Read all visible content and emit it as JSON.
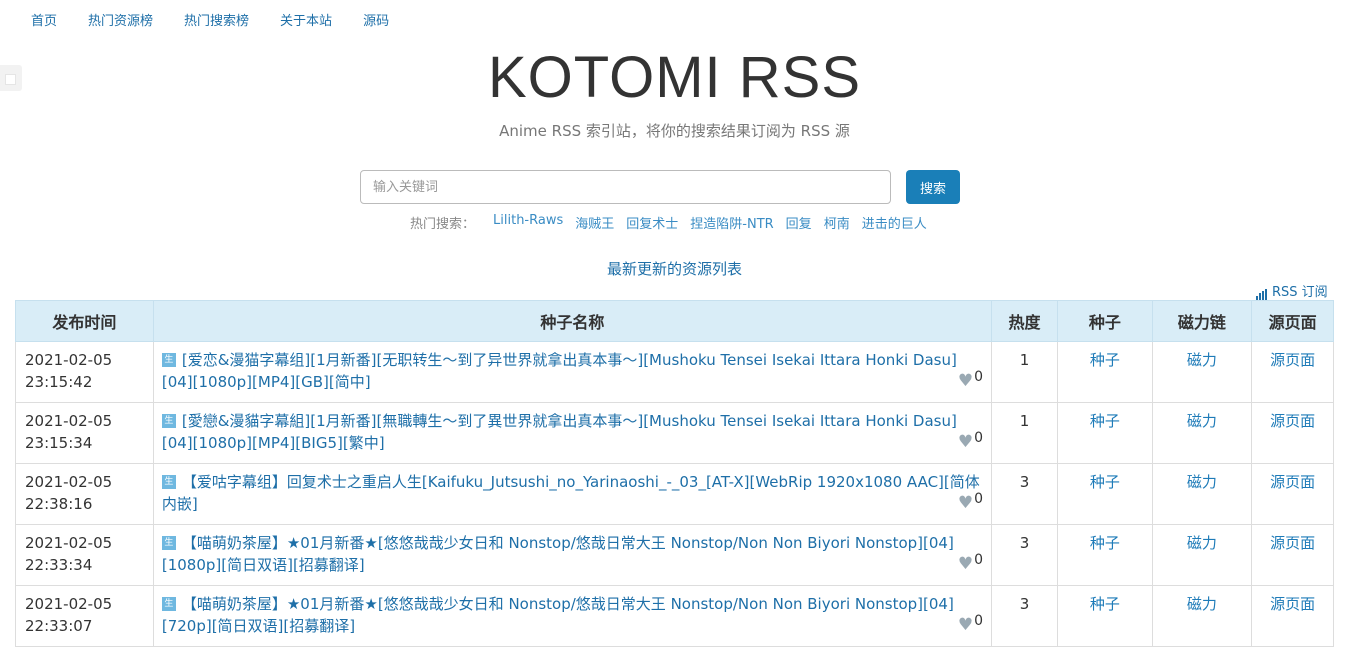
{
  "nav": [
    "首页",
    "热门资源榜",
    "热门搜索榜",
    "关于本站",
    "源码"
  ],
  "hero": {
    "title": "KOTOMI RSS",
    "subtitle": "Anime RSS 索引站，将你的搜索结果订阅为 RSS 源"
  },
  "search": {
    "placeholder": "输入关键词",
    "button": "搜索",
    "hot_label": "热门搜索：",
    "hot_terms": [
      "Lilith-Raws",
      "海贼王",
      "回复术士",
      "捏造陷阱-NTR",
      "回复",
      "柯南",
      "进击的巨人"
    ]
  },
  "section_title": "最新更新的资源列表",
  "rss_label": "RSS 订阅",
  "table": {
    "headers": [
      "发布时间",
      "种子名称",
      "热度",
      "种子",
      "磁力链",
      "源页面"
    ],
    "rows": [
      {
        "date": "2021-02-05",
        "time": "23:15:42",
        "tag": "生",
        "title": "[爱恋&漫猫字幕组][1月新番][无职转生～到了异世界就拿出真本事～][Mushoku Tensei Isekai Ittara Honki Dasu][04][1080p][MP4][GB][简中]",
        "fav": "0",
        "heat": "1",
        "seed": "种子",
        "magnet": "磁力",
        "source": "源页面"
      },
      {
        "date": "2021-02-05",
        "time": "23:15:34",
        "tag": "生",
        "title": "[愛戀&漫貓字幕組][1月新番][無職轉生～到了異世界就拿出真本事～][Mushoku Tensei Isekai Ittara Honki Dasu][04][1080p][MP4][BIG5][繁中]",
        "fav": "0",
        "heat": "1",
        "seed": "种子",
        "magnet": "磁力",
        "source": "源页面"
      },
      {
        "date": "2021-02-05",
        "time": "22:38:16",
        "tag": "生",
        "title": "【爱咕字幕组】回复术士之重启人生[Kaifuku_Jutsushi_no_Yarinaoshi_-_03_[AT-X][WebRip 1920x1080 AAC][简体内嵌]",
        "fav": "0",
        "heat": "3",
        "seed": "种子",
        "magnet": "磁力",
        "source": "源页面"
      },
      {
        "date": "2021-02-05",
        "time": "22:33:34",
        "tag": "生",
        "title": "【喵萌奶茶屋】★01月新番★[悠悠哉哉少女日和 Nonstop/悠哉日常大王 Nonstop/Non Non Biyori Nonstop][04][1080p][简日双语][招募翻译]",
        "fav": "0",
        "heat": "3",
        "seed": "种子",
        "magnet": "磁力",
        "source": "源页面"
      },
      {
        "date": "2021-02-05",
        "time": "22:33:07",
        "tag": "生",
        "title": "【喵萌奶茶屋】★01月新番★[悠悠哉哉少女日和 Nonstop/悠哉日常大王 Nonstop/Non Non Biyori Nonstop][04][720p][简日双语][招募翻译]",
        "fav": "0",
        "heat": "3",
        "seed": "种子",
        "magnet": "磁力",
        "source": "源页面"
      }
    ]
  }
}
